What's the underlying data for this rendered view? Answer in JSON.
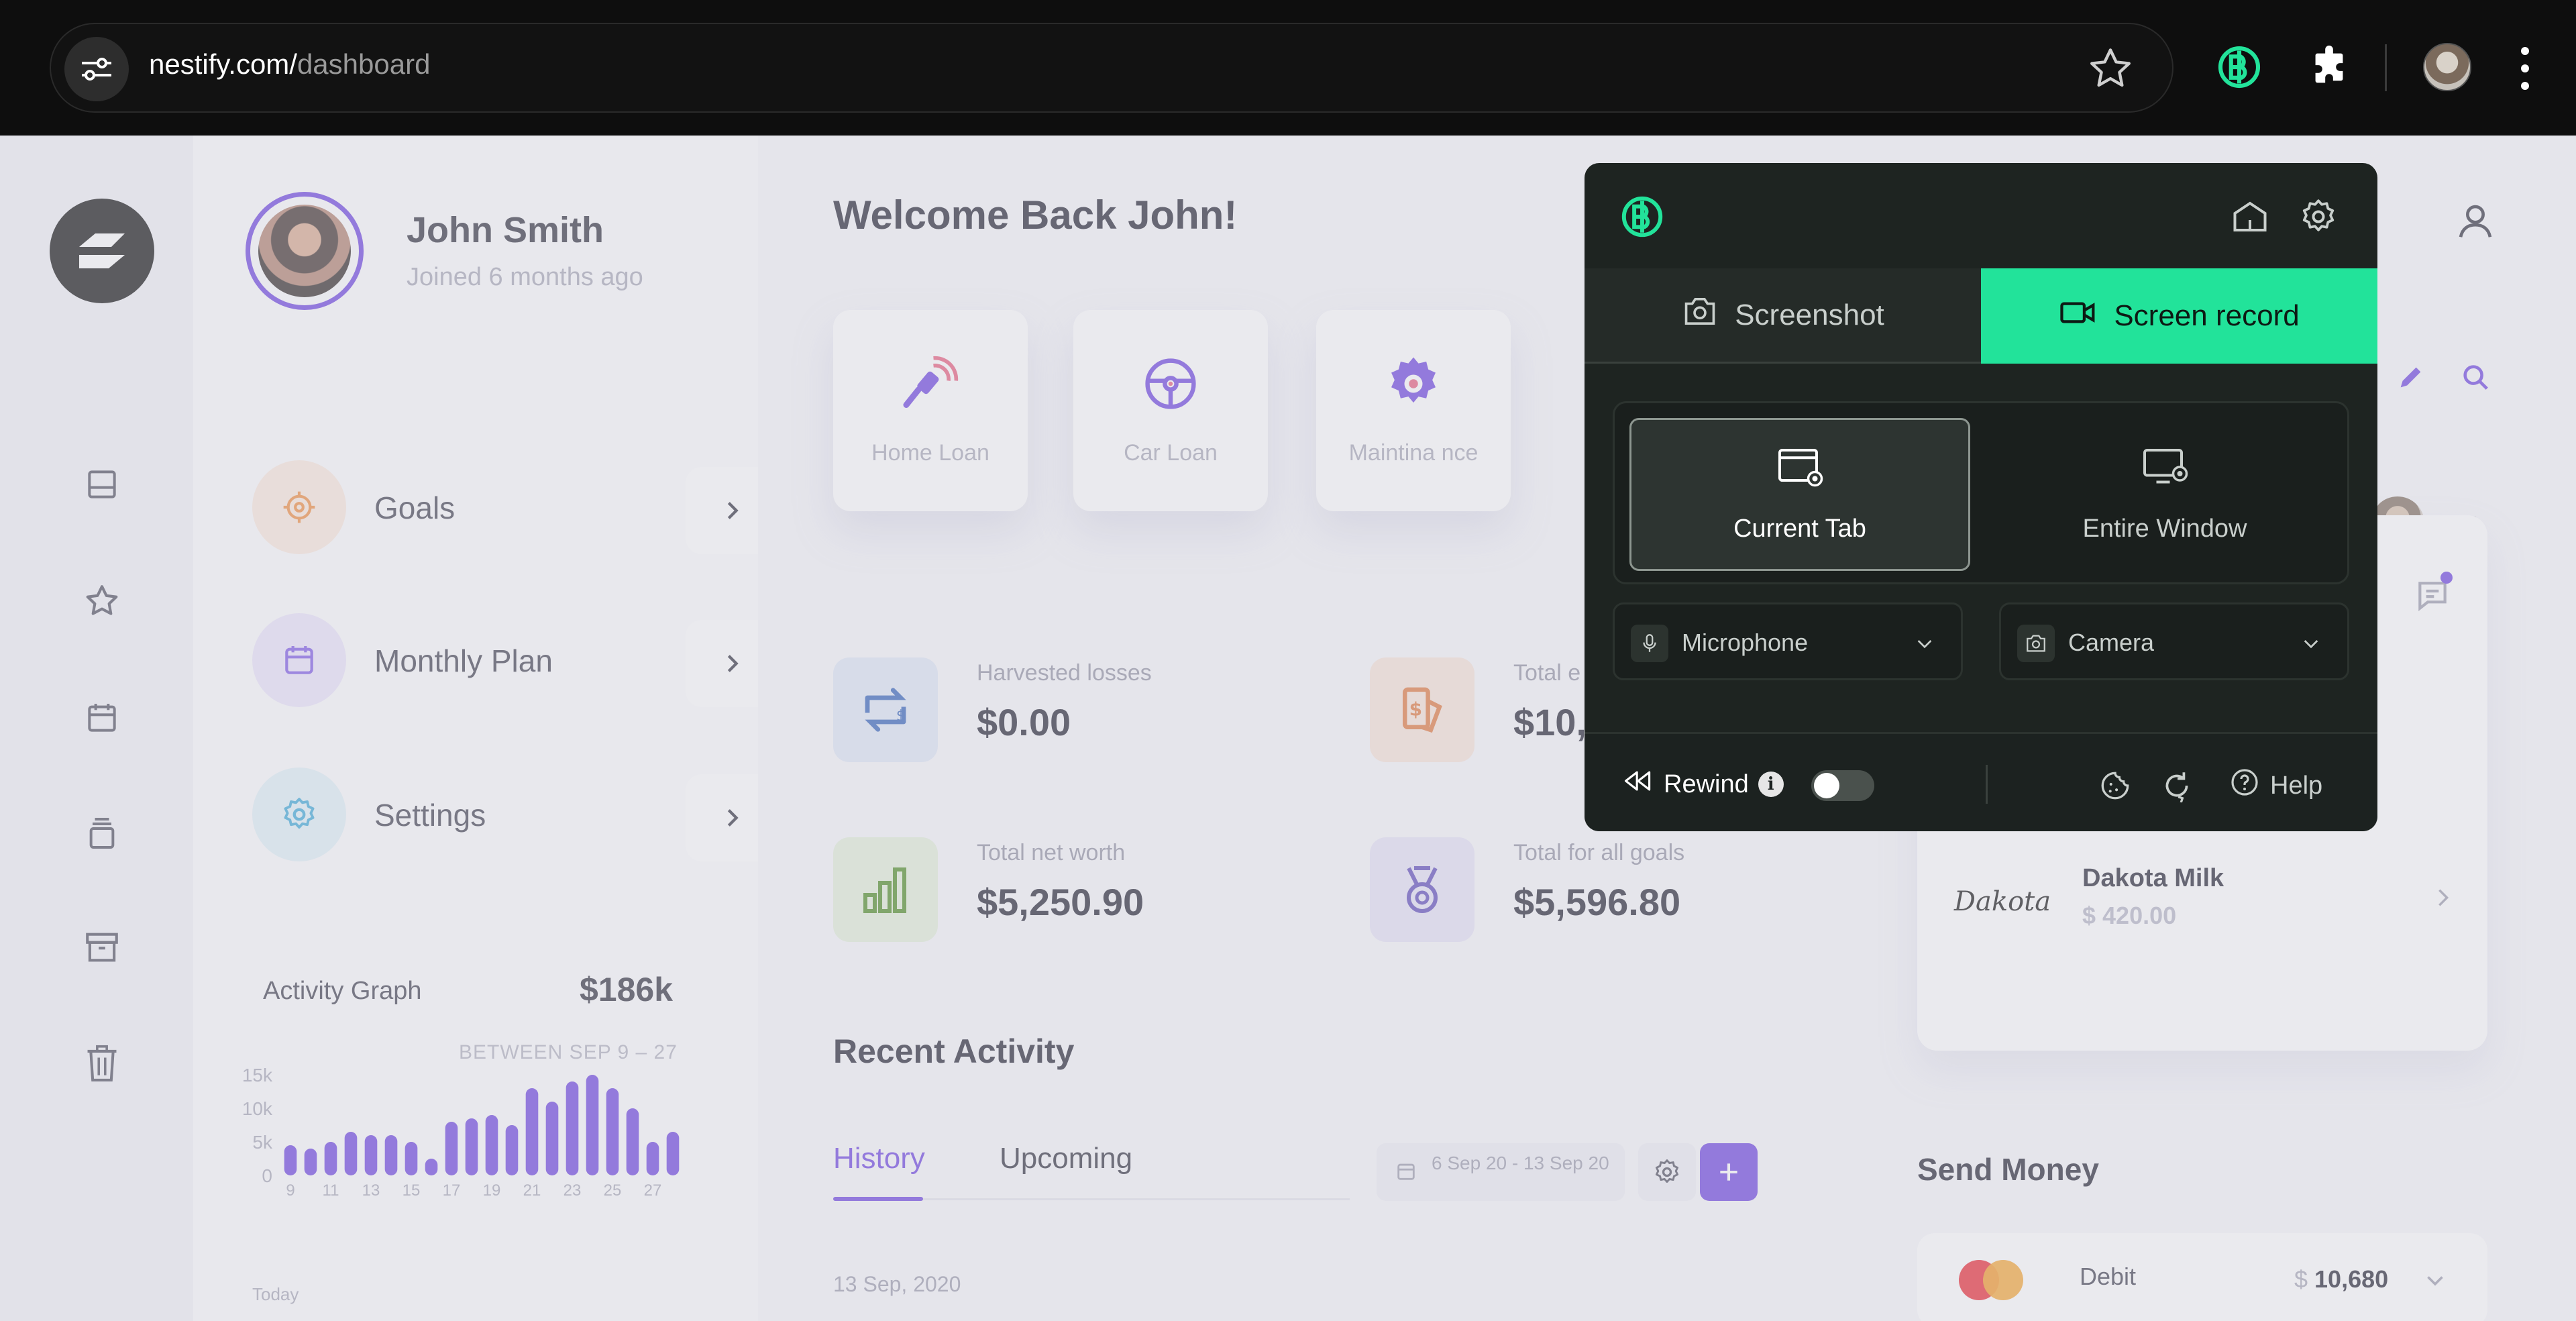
{
  "browser": {
    "url_domain": "nestify.com/",
    "url_path": "dashboard"
  },
  "sidebar_rail": {
    "items": [
      "inbox-icon",
      "star-icon",
      "calendar-icon",
      "stack-icon",
      "archive-icon",
      "trash-icon"
    ]
  },
  "profile": {
    "name": "John Smith",
    "joined": "Joined 6 months ago",
    "menu": [
      {
        "label": "Goals",
        "icon": "target-icon",
        "color": "#f08a3c"
      },
      {
        "label": "Monthly Plan",
        "icon": "calendar-icon",
        "color": "#7b55e6"
      },
      {
        "label": "Settings",
        "icon": "gear-icon",
        "color": "#3aa8d8"
      }
    ]
  },
  "activity": {
    "title": "Activity Graph",
    "total": "$186k",
    "range": "BETWEEN SEP 9 – 27",
    "today": "Today"
  },
  "chart_data": {
    "type": "bar",
    "title": "Activity Graph",
    "categories": [
      "9",
      "10",
      "11",
      "12",
      "13",
      "14",
      "15",
      "16",
      "17",
      "18",
      "19",
      "20",
      "21",
      "22",
      "23",
      "24",
      "25",
      "26",
      "27"
    ],
    "x_tick_labels": [
      "9",
      "11",
      "13",
      "15",
      "17",
      "19",
      "21",
      "23",
      "25",
      "27"
    ],
    "values": [
      4500,
      4000,
      5000,
      6500,
      6000,
      6000,
      5000,
      2500,
      8000,
      8500,
      9000,
      7500,
      13000,
      11000,
      14000,
      15000,
      13000,
      10000,
      5000,
      6500
    ],
    "y_tick_labels": [
      "15k",
      "10k",
      "5k",
      "0"
    ],
    "ylim": [
      0,
      15000
    ],
    "color": "#6a3ee0"
  },
  "main": {
    "welcome": "Welcome Back John!",
    "categories": [
      {
        "label": "Home Loan",
        "icon": "key-icon"
      },
      {
        "label": "Car Loan",
        "icon": "steering-wheel-icon"
      },
      {
        "label": "Maintina nce",
        "icon": "gear-icon"
      }
    ],
    "stats": [
      {
        "label": "Harvested losses",
        "value": "$0.00",
        "icon": "transfer-icon"
      },
      {
        "label": "Total e",
        "value": "$10,",
        "icon": "money-icon"
      },
      {
        "label": "Total net worth",
        "value": "$5,250.90",
        "icon": "bar-chart-icon"
      },
      {
        "label": "Total for all goals",
        "value": "$5,596.80",
        "icon": "medal-icon"
      }
    ],
    "recent_title": "Recent Activity",
    "tabs": {
      "history": "History",
      "upcoming": "Upcoming"
    },
    "date_filter": "6 Sep 20 - 13 Sep 20",
    "date_row": "13 Sep, 2020"
  },
  "right": {
    "merchant_logo": "Dakota",
    "merchant_name": "Dakota Milk",
    "merchant_amount": "$ 420.00",
    "send_money": "Send Money",
    "debit_label": "Debit",
    "debit_currency": "$",
    "debit_amount": "10,680"
  },
  "popup": {
    "tabs": {
      "screenshot": "Screenshot",
      "record": "Screen record"
    },
    "sources": {
      "current": "Current Tab",
      "window": "Entire Window"
    },
    "microphone": "Microphone",
    "camera": "Camera",
    "rewind": "Rewind",
    "info": "i",
    "help": "Help",
    "accent": "#22e39a"
  }
}
